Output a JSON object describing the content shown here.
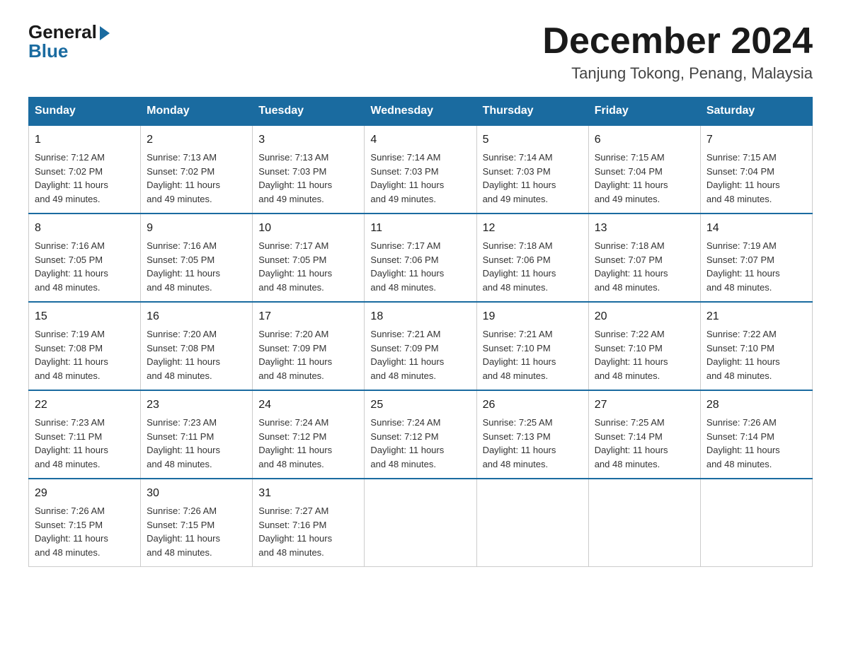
{
  "logo": {
    "general": "General",
    "blue": "Blue"
  },
  "title": "December 2024",
  "location": "Tanjung Tokong, Penang, Malaysia",
  "days_of_week": [
    "Sunday",
    "Monday",
    "Tuesday",
    "Wednesday",
    "Thursday",
    "Friday",
    "Saturday"
  ],
  "weeks": [
    [
      {
        "day": "1",
        "sunrise": "7:12 AM",
        "sunset": "7:02 PM",
        "daylight": "11 hours and 49 minutes."
      },
      {
        "day": "2",
        "sunrise": "7:13 AM",
        "sunset": "7:02 PM",
        "daylight": "11 hours and 49 minutes."
      },
      {
        "day": "3",
        "sunrise": "7:13 AM",
        "sunset": "7:03 PM",
        "daylight": "11 hours and 49 minutes."
      },
      {
        "day": "4",
        "sunrise": "7:14 AM",
        "sunset": "7:03 PM",
        "daylight": "11 hours and 49 minutes."
      },
      {
        "day": "5",
        "sunrise": "7:14 AM",
        "sunset": "7:03 PM",
        "daylight": "11 hours and 49 minutes."
      },
      {
        "day": "6",
        "sunrise": "7:15 AM",
        "sunset": "7:04 PM",
        "daylight": "11 hours and 49 minutes."
      },
      {
        "day": "7",
        "sunrise": "7:15 AM",
        "sunset": "7:04 PM",
        "daylight": "11 hours and 48 minutes."
      }
    ],
    [
      {
        "day": "8",
        "sunrise": "7:16 AM",
        "sunset": "7:05 PM",
        "daylight": "11 hours and 48 minutes."
      },
      {
        "day": "9",
        "sunrise": "7:16 AM",
        "sunset": "7:05 PM",
        "daylight": "11 hours and 48 minutes."
      },
      {
        "day": "10",
        "sunrise": "7:17 AM",
        "sunset": "7:05 PM",
        "daylight": "11 hours and 48 minutes."
      },
      {
        "day": "11",
        "sunrise": "7:17 AM",
        "sunset": "7:06 PM",
        "daylight": "11 hours and 48 minutes."
      },
      {
        "day": "12",
        "sunrise": "7:18 AM",
        "sunset": "7:06 PM",
        "daylight": "11 hours and 48 minutes."
      },
      {
        "day": "13",
        "sunrise": "7:18 AM",
        "sunset": "7:07 PM",
        "daylight": "11 hours and 48 minutes."
      },
      {
        "day": "14",
        "sunrise": "7:19 AM",
        "sunset": "7:07 PM",
        "daylight": "11 hours and 48 minutes."
      }
    ],
    [
      {
        "day": "15",
        "sunrise": "7:19 AM",
        "sunset": "7:08 PM",
        "daylight": "11 hours and 48 minutes."
      },
      {
        "day": "16",
        "sunrise": "7:20 AM",
        "sunset": "7:08 PM",
        "daylight": "11 hours and 48 minutes."
      },
      {
        "day": "17",
        "sunrise": "7:20 AM",
        "sunset": "7:09 PM",
        "daylight": "11 hours and 48 minutes."
      },
      {
        "day": "18",
        "sunrise": "7:21 AM",
        "sunset": "7:09 PM",
        "daylight": "11 hours and 48 minutes."
      },
      {
        "day": "19",
        "sunrise": "7:21 AM",
        "sunset": "7:10 PM",
        "daylight": "11 hours and 48 minutes."
      },
      {
        "day": "20",
        "sunrise": "7:22 AM",
        "sunset": "7:10 PM",
        "daylight": "11 hours and 48 minutes."
      },
      {
        "day": "21",
        "sunrise": "7:22 AM",
        "sunset": "7:10 PM",
        "daylight": "11 hours and 48 minutes."
      }
    ],
    [
      {
        "day": "22",
        "sunrise": "7:23 AM",
        "sunset": "7:11 PM",
        "daylight": "11 hours and 48 minutes."
      },
      {
        "day": "23",
        "sunrise": "7:23 AM",
        "sunset": "7:11 PM",
        "daylight": "11 hours and 48 minutes."
      },
      {
        "day": "24",
        "sunrise": "7:24 AM",
        "sunset": "7:12 PM",
        "daylight": "11 hours and 48 minutes."
      },
      {
        "day": "25",
        "sunrise": "7:24 AM",
        "sunset": "7:12 PM",
        "daylight": "11 hours and 48 minutes."
      },
      {
        "day": "26",
        "sunrise": "7:25 AM",
        "sunset": "7:13 PM",
        "daylight": "11 hours and 48 minutes."
      },
      {
        "day": "27",
        "sunrise": "7:25 AM",
        "sunset": "7:14 PM",
        "daylight": "11 hours and 48 minutes."
      },
      {
        "day": "28",
        "sunrise": "7:26 AM",
        "sunset": "7:14 PM",
        "daylight": "11 hours and 48 minutes."
      }
    ],
    [
      {
        "day": "29",
        "sunrise": "7:26 AM",
        "sunset": "7:15 PM",
        "daylight": "11 hours and 48 minutes."
      },
      {
        "day": "30",
        "sunrise": "7:26 AM",
        "sunset": "7:15 PM",
        "daylight": "11 hours and 48 minutes."
      },
      {
        "day": "31",
        "sunrise": "7:27 AM",
        "sunset": "7:16 PM",
        "daylight": "11 hours and 48 minutes."
      },
      null,
      null,
      null,
      null
    ]
  ],
  "labels": {
    "sunrise": "Sunrise:",
    "sunset": "Sunset:",
    "daylight": "Daylight:"
  }
}
